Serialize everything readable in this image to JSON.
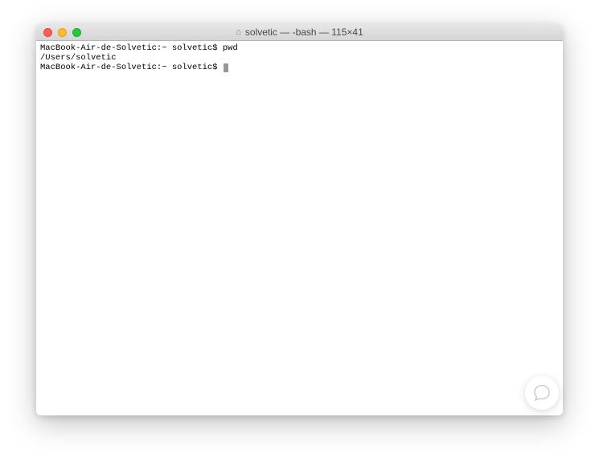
{
  "window": {
    "title": "solvetic — -bash — 115×41",
    "icon": "home-icon"
  },
  "traffic": {
    "close": "close",
    "minimize": "minimize",
    "maximize": "maximize"
  },
  "terminal": {
    "lines": [
      {
        "prompt": "MacBook-Air-de-Solvetic:~ solvetic$ ",
        "command": "pwd"
      },
      {
        "output": "/Users/solvetic"
      },
      {
        "prompt": "MacBook-Air-de-Solvetic:~ solvetic$ ",
        "command": "",
        "cursor": true
      }
    ]
  },
  "chat": {
    "label": "chat-help"
  }
}
